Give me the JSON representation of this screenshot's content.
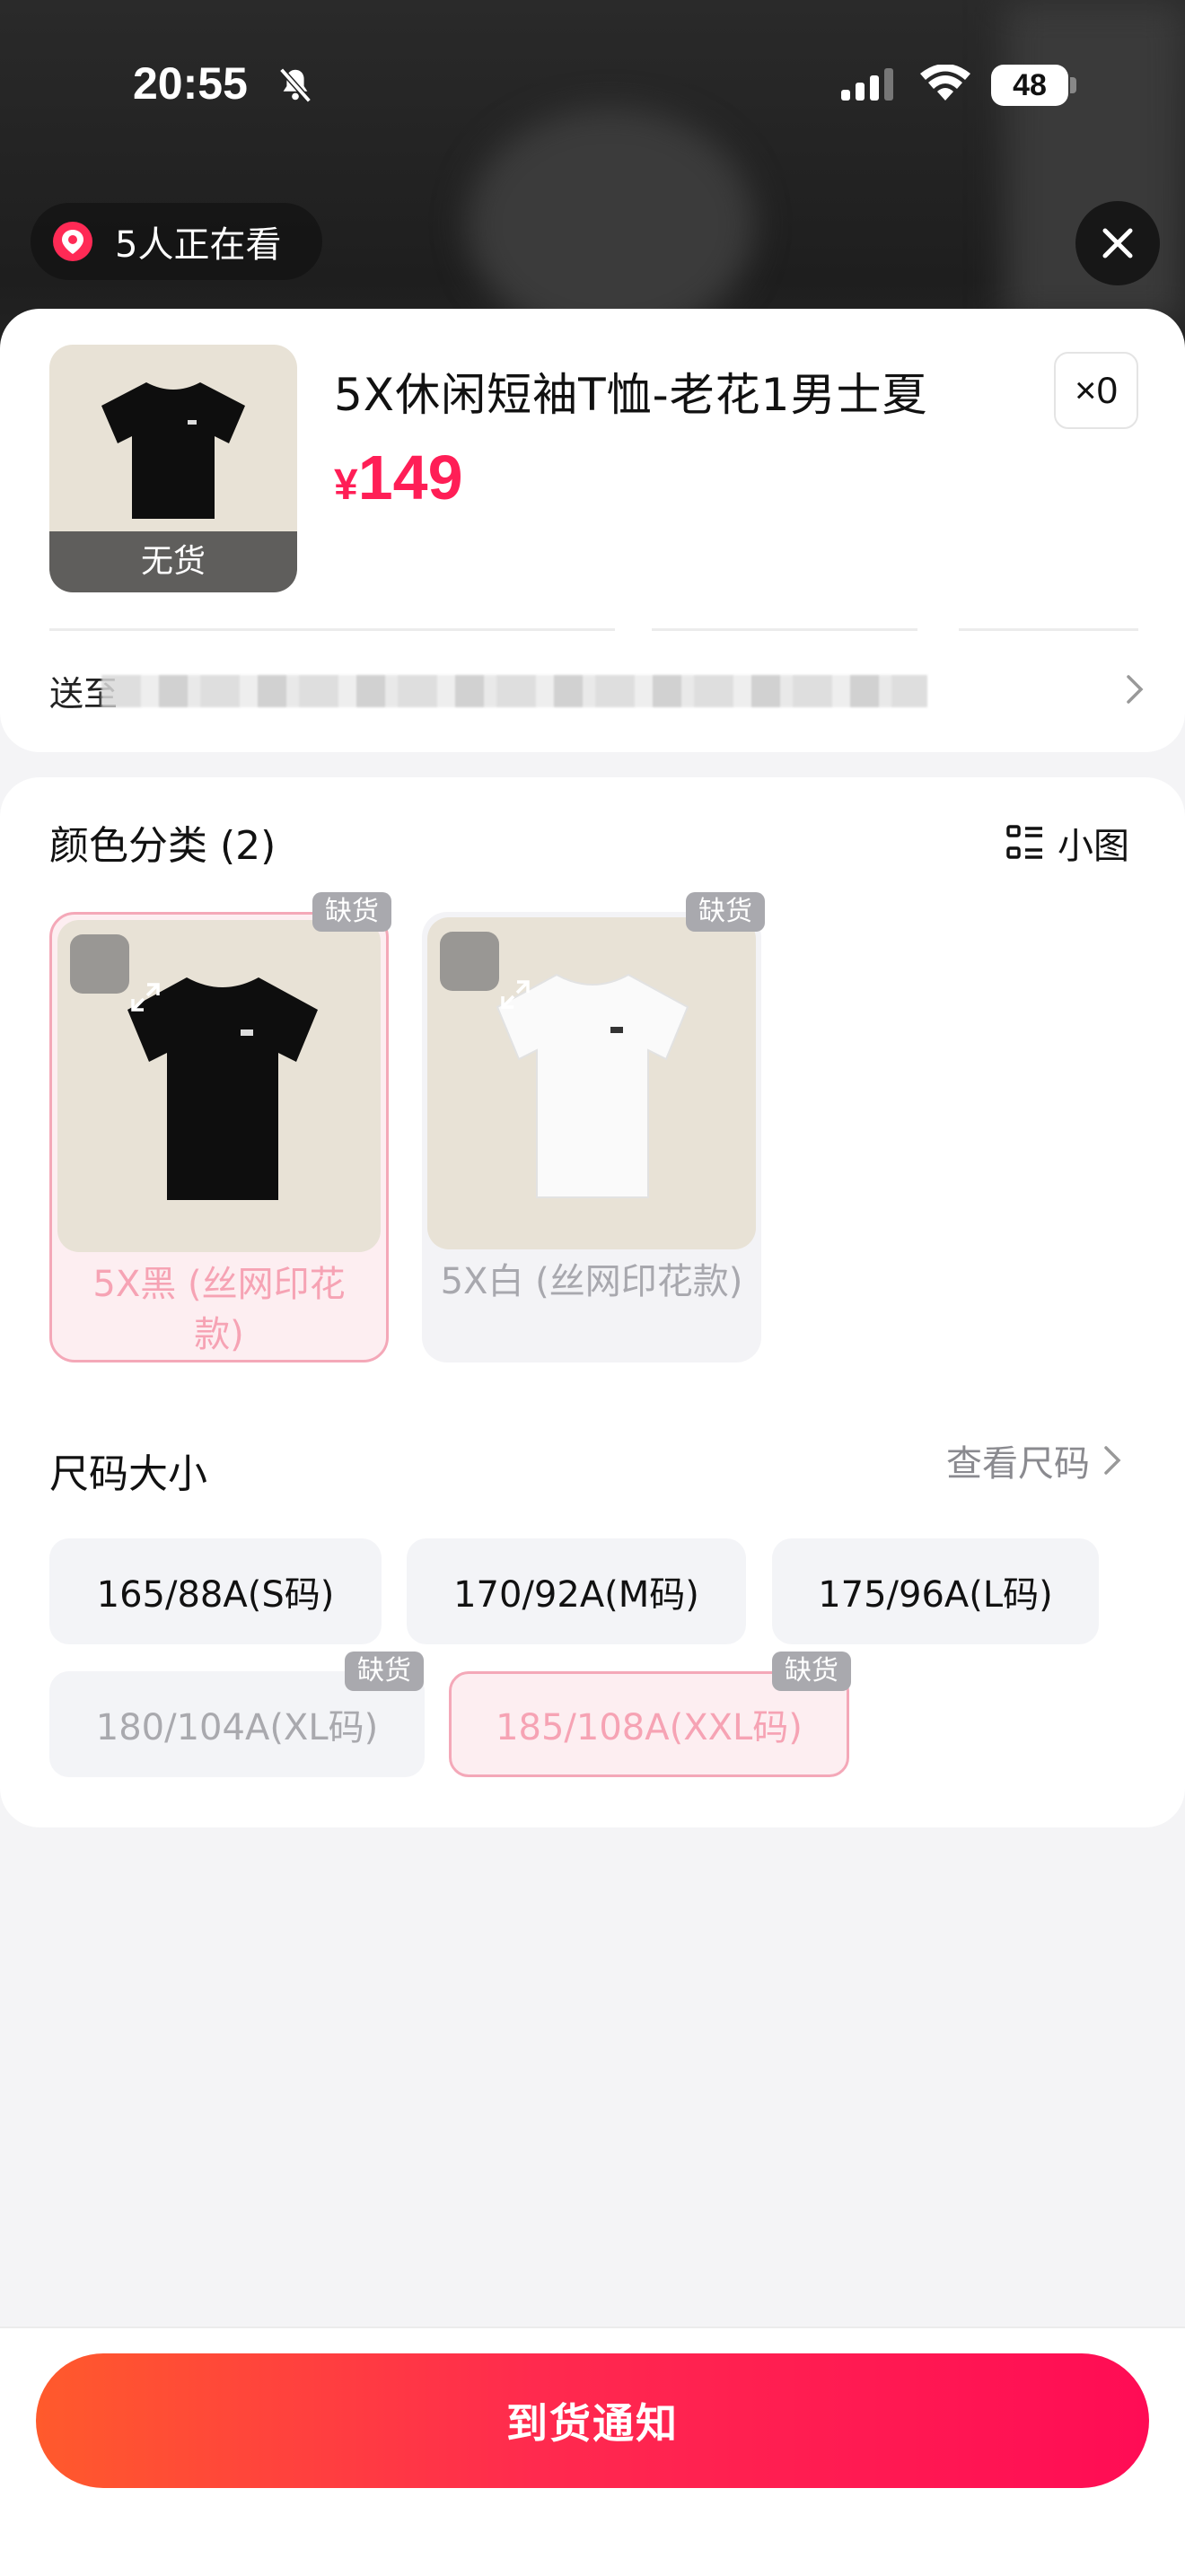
{
  "status_bar": {
    "time": "20:55",
    "battery": "48"
  },
  "overlay": {
    "viewers_label": "5人正在看"
  },
  "product": {
    "title": "5X休闲短袖T恤-老花1男士夏",
    "currency": "¥",
    "price": "149",
    "thumbnail_badge": "无货",
    "quantity": "×0",
    "ship_to_label": "送至"
  },
  "color_section": {
    "title": "颜色分类 (2)",
    "view_toggle_label": "小图",
    "options": [
      {
        "name": "5X黑 (丝网印花款)",
        "badge": "缺货",
        "shirt_color": "#0e0e0e",
        "selected": true
      },
      {
        "name": "5X白 (丝网印花款)",
        "badge": "缺货",
        "shirt_color": "#fafafa",
        "selected": false
      }
    ]
  },
  "size_section": {
    "title": "尺码大小",
    "size_chart_link": "查看尺码",
    "options": [
      {
        "label": "165/88A(S码)",
        "badge": "",
        "state": "available"
      },
      {
        "label": "170/92A(M码)",
        "badge": "",
        "state": "available"
      },
      {
        "label": "175/96A(L码)",
        "badge": "",
        "state": "available"
      },
      {
        "label": "180/104A(XL码)",
        "badge": "缺货",
        "state": "disabled"
      },
      {
        "label": "185/108A(XXL码)",
        "badge": "缺货",
        "state": "selected"
      }
    ]
  },
  "cta": {
    "label": "到货通知"
  },
  "colors": {
    "price": "#ff1e56",
    "accent_border": "#f4a8b8",
    "accent_fill": "#fdeef1",
    "cta_gradient_start": "#ff5a2c",
    "cta_gradient_end": "#ff0c55"
  }
}
